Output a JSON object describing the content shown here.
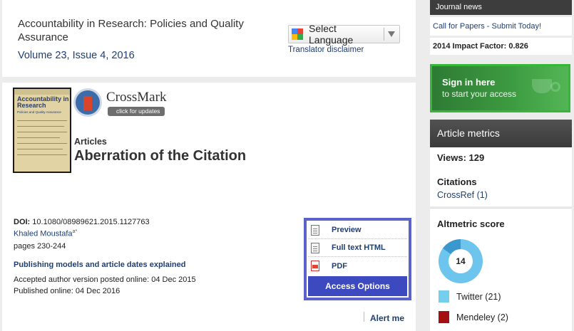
{
  "journal": {
    "title": "Accountability in Research: Policies and Quality Assurance",
    "volume": "Volume 23, Issue 4, 2016"
  },
  "language": {
    "select_label": "Select Language",
    "disclaimer": "Translator disclaimer"
  },
  "cover": {
    "title": "Accountability in Research",
    "subtitle": "Policies and Quality Assurance"
  },
  "crossmark": {
    "name": "CrossMark",
    "button": "click for updates"
  },
  "article": {
    "type": "Articles",
    "title": "Aberration of the Citation",
    "doi_label": "DOI:",
    "doi": "10.1080/08989621.2015.1127763",
    "author": "Khaled Moustafa",
    "author_sup": "a*",
    "pages": "pages 230-244",
    "pub_models_link": "Publishing models and article dates explained",
    "accepted": "Accepted author version posted online: 04 Dec 2015",
    "published": "Published online: 04 Dec 2016"
  },
  "options": {
    "preview": "Preview",
    "fulltext": "Full text HTML",
    "pdf": "PDF",
    "access": "Access Options"
  },
  "alert": "Alert me",
  "sidebar": {
    "news_heading": "Journal news",
    "news_link": "Call for Papers - Submit Today!",
    "impact": "2014 Impact Factor: 0.826",
    "signin_line1": "Sign in here",
    "signin_line2": "to start your access",
    "metrics_heading": "Article metrics",
    "views": "Views: 129",
    "citations_heading": "Citations",
    "crossref": "CrossRef (1)",
    "altmetric_heading": "Altmetric score",
    "altmetric_score": "14",
    "twitter": "Twitter (21)",
    "mendeley": "Mendeley (2)"
  },
  "colors": {
    "twitter": "#74cfee",
    "mendeley": "#a60f0f",
    "access_button": "#3d4abf",
    "signin_green": "#38b63a"
  }
}
